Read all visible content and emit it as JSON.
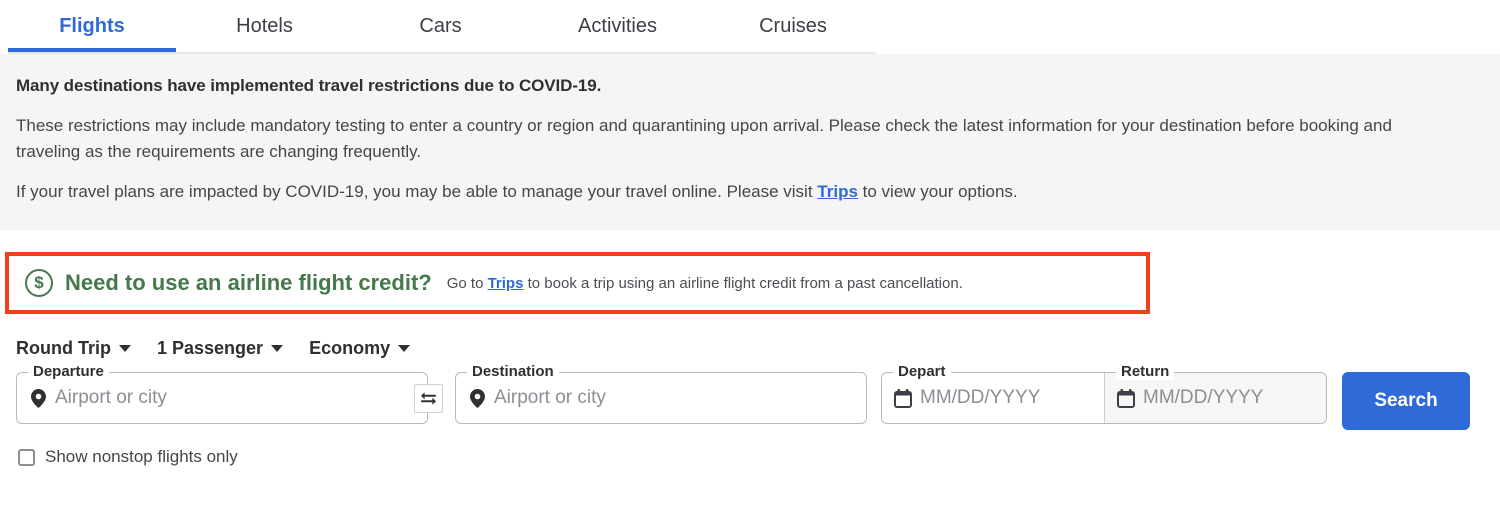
{
  "tabs": [
    {
      "label": "Flights",
      "active": true
    },
    {
      "label": "Hotels",
      "active": false
    },
    {
      "label": "Cars",
      "active": false
    },
    {
      "label": "Activities",
      "active": false
    },
    {
      "label": "Cruises",
      "active": false
    }
  ],
  "covid_notice": {
    "heading": "Many destinations have implemented travel restrictions due to COVID-19.",
    "paragraph1": "These restrictions may include mandatory testing to enter a country or region and quarantining upon arrival. Please check the latest information for your destination before booking and traveling as the requirements are changing frequently.",
    "paragraph2_before": "If your travel plans are impacted by COVID-19, you may be able to manage your travel online. Please visit",
    "paragraph2_link": "Trips",
    "paragraph2_after": "to view your options."
  },
  "flight_credit": {
    "icon": "dollar-circle-icon",
    "dollar_glyph": "$",
    "heading": "Need to use an airline flight credit?",
    "sub_before": "Go to",
    "sub_link": "Trips",
    "sub_after": "to book a trip using an airline flight credit from a past cancellation.",
    "highlight_color": "#f0401a",
    "text_color": "#45794b"
  },
  "options": [
    {
      "label": "Round Trip"
    },
    {
      "label": "1 Passenger"
    },
    {
      "label": "Economy"
    }
  ],
  "search_form": {
    "departure": {
      "label": "Departure",
      "value": "",
      "placeholder": "Airport or city",
      "icon": "location-pin-icon"
    },
    "swap": {
      "icon": "swap-arrows-icon"
    },
    "destination": {
      "label": "Destination",
      "value": "",
      "placeholder": "Airport or city",
      "icon": "location-pin-icon"
    },
    "depart_date": {
      "label": "Depart",
      "value": "",
      "placeholder": "MM/DD/YYYY",
      "icon": "calendar-icon"
    },
    "return_date": {
      "label": "Return",
      "value": "",
      "placeholder": "MM/DD/YYYY",
      "icon": "calendar-icon"
    },
    "search_button": "Search",
    "accent_color": "#2f6ad9"
  },
  "bottom_row": {
    "checkbox_label": "Show nonstop flights only"
  }
}
